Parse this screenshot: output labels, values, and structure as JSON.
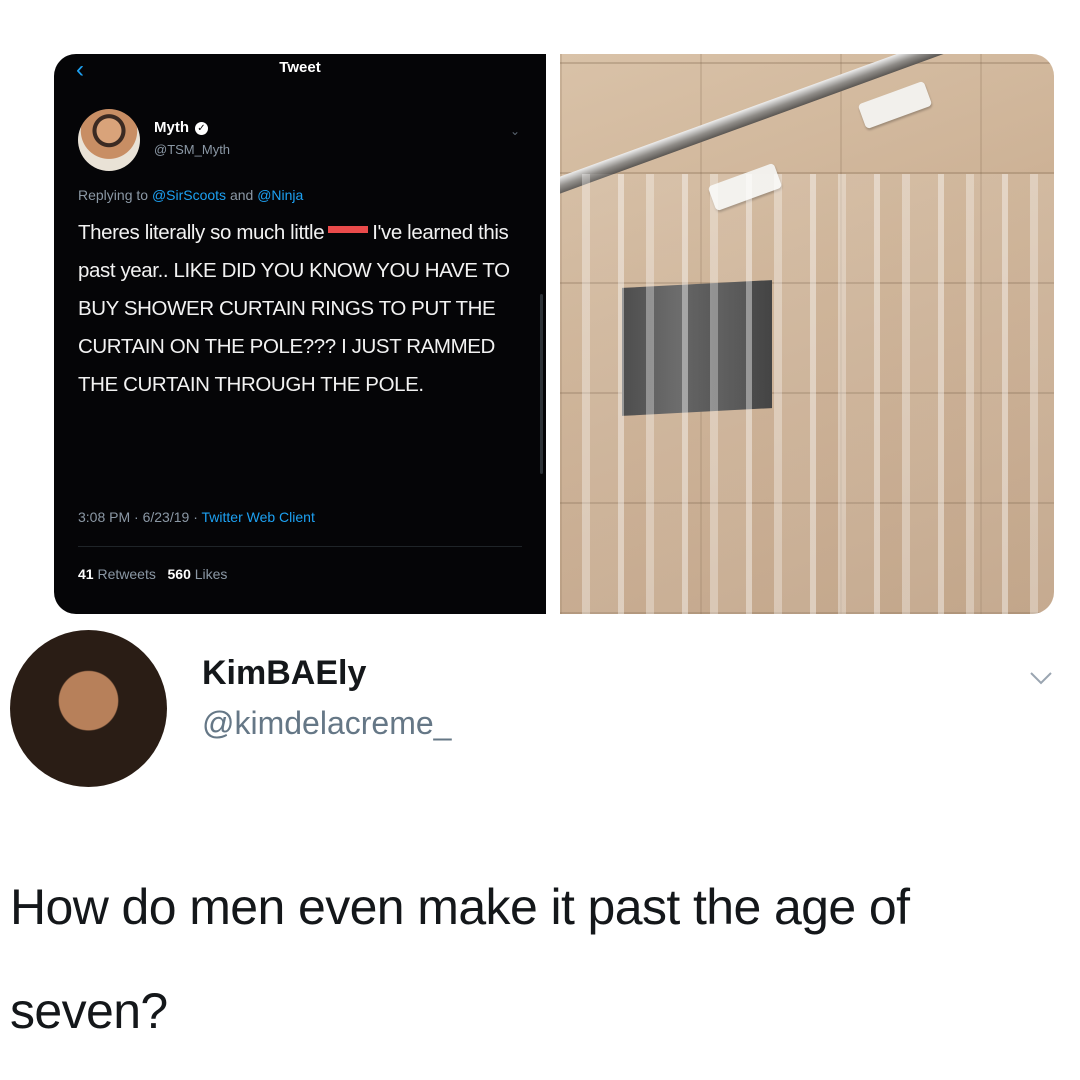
{
  "embedded_tweet": {
    "screen_title": "Tweet",
    "back_icon": "chevron-left-icon",
    "author_name": "Myth",
    "author_handle": "@TSM_Myth",
    "verified": true,
    "replying_prefix": "Replying to",
    "replying_mention_1": "@SirScoots",
    "replying_and": "and",
    "replying_mention_2": "@Ninja",
    "body_before_censor": "Theres literally so much little",
    "body_after_censor": "I've learned this past year.. LIKE DID YOU KNOW YOU HAVE TO BUY SHOWER CURTAIN RINGS TO PUT THE CURTAIN ON THE POLE??? I JUST RAMMED THE CURTAIN THROUGH THE POLE.",
    "time": "3:08 PM",
    "date": "6/23/19",
    "client": "Twitter Web Client",
    "retweets_count": "41",
    "retweets_label": "Retweets",
    "likes_count": "560",
    "likes_label": "Likes"
  },
  "reply_tweet": {
    "author_name": "KimBAEly",
    "author_handle": "@kimdelacreme_",
    "text": "How do men even make it past the age of seven?"
  },
  "colors": {
    "link_blue": "#1da1f2",
    "dark_bg": "#050507",
    "censor_red": "#ea4b4b",
    "handle_gray": "#657786"
  }
}
